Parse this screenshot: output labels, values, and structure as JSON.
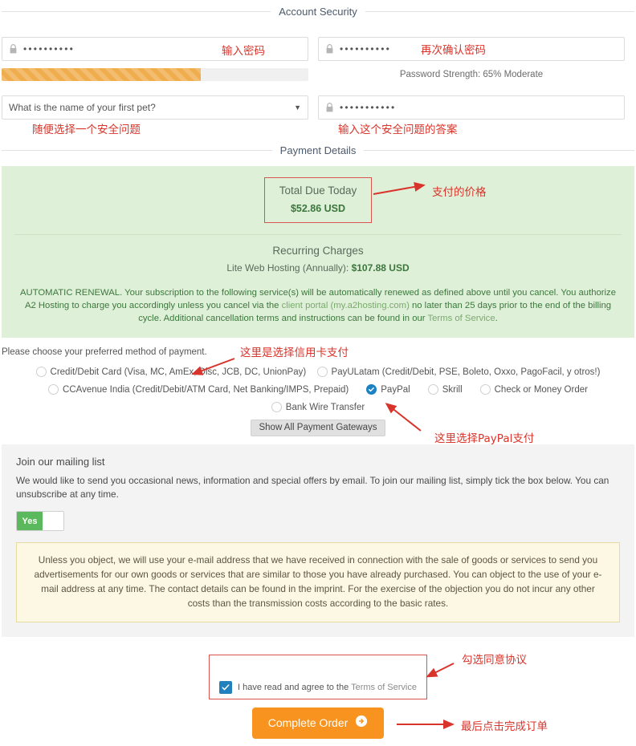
{
  "sections": {
    "account_security": "Account Security",
    "payment_details": "Payment Details"
  },
  "account_security": {
    "password": {
      "value": "••••••••••",
      "icon": "lock-icon"
    },
    "confirm_password": {
      "value": "••••••••••",
      "icon": "lock-icon"
    },
    "password_strength": "Password Strength: 65% Moderate",
    "password_strength_percent": 65,
    "security_question": "What is the name of your first pet?",
    "security_answer": {
      "value": "•••••••••••",
      "icon": "lock-icon"
    }
  },
  "payment": {
    "total_due_label": "Total Due Today",
    "total_due_amount": "$52.86 USD",
    "recurring_title": "Recurring Charges",
    "recurring_item": "Lite Web Hosting (Annually): ",
    "recurring_amount": "$107.88 USD",
    "renewal_part1": "AUTOMATIC RENEWAL. Your subscription to the following service(s) will be automatically renewed as defined above until you cancel. You authorize A2 Hosting to charge you accordingly unless you cancel via the ",
    "renewal_link1": "client portal (my.a2hosting.com)",
    "renewal_part2": " no later than 25 days prior to the end of the billing cycle. Additional cancellation terms and instructions can be found in our ",
    "renewal_link2": "Terms of Service",
    "renewal_part3": ".",
    "choose_method": "Please choose your preferred method of payment.",
    "methods": [
      {
        "label": "Credit/Debit Card (Visa, MC, AmEx, Disc, JCB, DC, UnionPay)",
        "selected": false
      },
      {
        "label": "PayULatam (Credit/Debit, PSE, Boleto, Oxxo, PagoFacil, y otros!)",
        "selected": false
      },
      {
        "label": "CCAvenue India (Credit/Debit/ATM Card, Net Banking/IMPS, Prepaid)",
        "selected": false
      },
      {
        "label": "PayPal",
        "selected": true
      },
      {
        "label": "Skrill",
        "selected": false
      },
      {
        "label": "Check or Money Order",
        "selected": false
      },
      {
        "label": "Bank Wire Transfer",
        "selected": false
      }
    ],
    "show_all_gateways": "Show All Payment Gateways"
  },
  "mailing": {
    "title": "Join our mailing list",
    "body": "We would like to send you occasional news, information and special offers by email. To join our mailing list, simply tick the box below. You can unsubscribe at any time.",
    "toggle_label": "Yes",
    "toggle_state": "on",
    "notice": "Unless you object, we will use your e-mail address that we have received in connection with the sale of goods or services to send you advertisements for our own goods or services that are similar to those you have already purchased. You can object to the use of your e-mail address at any time. The contact details can be found in the imprint. For the exercise of the objection you do not incur any other costs than the transmission costs according to the basic rates."
  },
  "footer": {
    "tos_text": "I have read and agree to the ",
    "tos_link": "Terms of Service",
    "tos_checked": true,
    "submit_label": "Complete Order"
  },
  "annotations": {
    "a1": "输入密码",
    "a2": "再次确认密码",
    "a3": "随便选择一个安全问题",
    "a4": "输入这个安全问题的答案",
    "a5": "支付的价格",
    "a6": "这里是选择信用卡支付",
    "a7": "这里选择PayPal支付",
    "a8": "勾选同意协议",
    "a9": "最后点击完成订单"
  },
  "colors": {
    "annotation": "#d9342b",
    "accent_orange": "#f7931e",
    "green_panel": "#dff0d8",
    "green_text": "#3c763d",
    "radio_selected": "#1b82c4",
    "checkbox": "#2280bd",
    "toggle_on": "#5cb85c",
    "strength_bar": "#f0ad4e"
  }
}
